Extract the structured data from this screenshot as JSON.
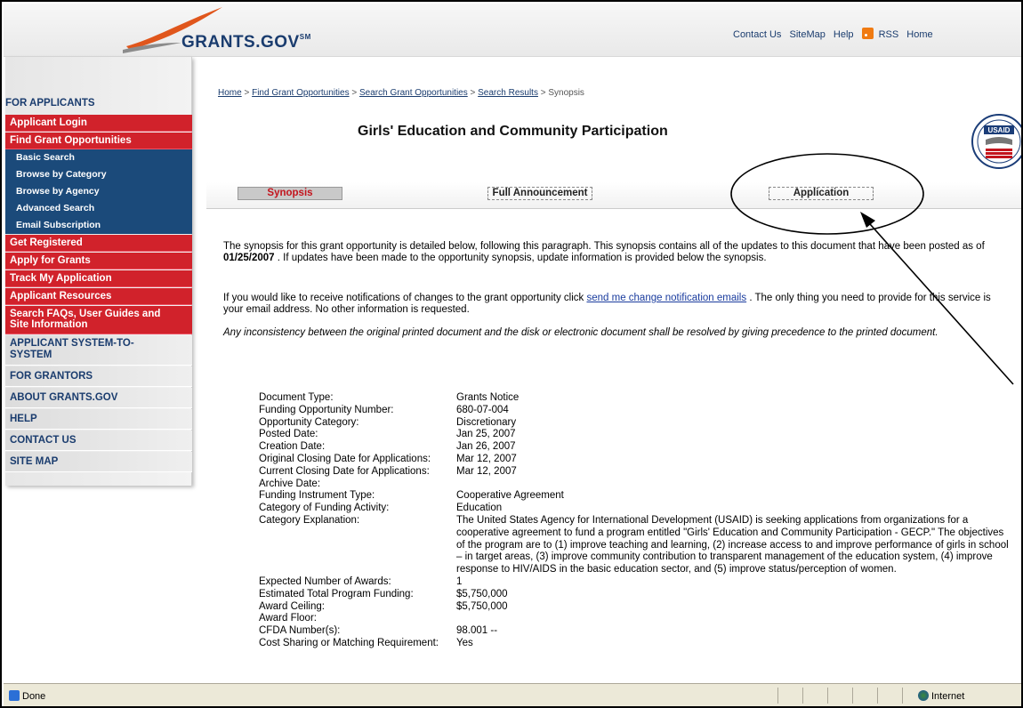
{
  "header": {
    "logo_text": "GRANTS.GOV",
    "logo_sm": "SM",
    "links": [
      "Contact Us",
      "SiteMap",
      "Help",
      "RSS",
      "Home"
    ]
  },
  "sidebar": {
    "heading": "FOR APPLICANTS",
    "applicant_login": "Applicant Login",
    "find_grant": "Find Grant Opportunities",
    "sub_items": [
      "Basic Search",
      "Browse by Category",
      "Browse by Agency",
      "Advanced Search",
      "Email Subscription"
    ],
    "get_registered": "Get Registered",
    "apply_for_grants": "Apply for Grants",
    "track_my_application": "Track My Application",
    "applicant_resources": "Applicant Resources",
    "search_faqs_line1": "Search FAQs, User Guides and",
    "search_faqs_line2": "Site Information",
    "sections": [
      "APPLICANT SYSTEM-TO-",
      "SYSTEM",
      "FOR GRANTORS",
      "ABOUT GRANTS.GOV",
      "HELP",
      "CONTACT US",
      "SITE MAP"
    ]
  },
  "breadcrumb": {
    "home": "Home",
    "find": "Find Grant Opportunities",
    "search": "Search Grant Opportunities",
    "results": "Search Results",
    "current": "Synopsis",
    "sep": " > "
  },
  "page_title": "Girls' Education and Community Participation",
  "seal_text": "USAID",
  "tabs": {
    "synopsis": "Synopsis",
    "full": "Full Announcement",
    "application": "Application"
  },
  "intro": {
    "p1_a": "The synopsis for this grant opportunity is detailed below, following this paragraph. This synopsis contains all of the updates to this document that have been posted as of",
    "p1_date": "01/25/2007",
    "p1_b": ". If updates have been made to the opportunity synopsis, update information is provided below the synopsis.",
    "p2_a": "If you would like to receive notifications of changes to the grant opportunity click",
    "p2_link": "send me change notification emails",
    "p2_b": ". The only thing you need to provide for this service is your email address. No other information is requested.",
    "p3": "Any inconsistency between the original printed document and the disk or electronic document shall be resolved by giving precedence to the printed document."
  },
  "details": [
    {
      "label": "Document Type:",
      "value": "Grants Notice"
    },
    {
      "label": "Funding Opportunity Number:",
      "value": "680-07-004"
    },
    {
      "label": "Opportunity Category:",
      "value": "Discretionary"
    },
    {
      "label": "Posted Date:",
      "value": "Jan 25, 2007"
    },
    {
      "label": "Creation Date:",
      "value": "Jan 26, 2007"
    },
    {
      "label": "Original Closing Date for Applications:",
      "value": "Mar 12, 2007"
    },
    {
      "label": "Current Closing Date for Applications:",
      "value": "Mar 12, 2007"
    },
    {
      "label": "Archive Date:",
      "value": ""
    },
    {
      "label": "Funding Instrument Type:",
      "value": "Cooperative Agreement"
    },
    {
      "label": "Category of Funding Activity:",
      "value": "Education"
    },
    {
      "label": "Category Explanation:",
      "value": "The United States Agency for International Development (USAID) is seeking applications from organizations for a cooperative agreement to fund a program entitled \"Girls' Education and Community Participation - GECP.\" The objectives of the program are to (1) improve teaching and learning, (2) increase access to and improve performance of girls in school – in target areas, (3) improve community contribution to transparent management of the education system, (4) improve response to HIV/AIDS in the basic education sector, and (5) improve status/perception of women."
    },
    {
      "label": "Expected Number of Awards:",
      "value": "1"
    },
    {
      "label": "Estimated Total Program Funding:",
      "value": "$5,750,000"
    },
    {
      "label": "Award Ceiling:",
      "value": "$5,750,000"
    },
    {
      "label": "Award Floor:",
      "value": ""
    },
    {
      "label": "CFDA Number(s):",
      "value": "98.001 --"
    },
    {
      "label": "Cost Sharing or Matching Requirement:",
      "value": "Yes"
    }
  ],
  "statusbar": {
    "left": "Done",
    "zone": "Internet"
  }
}
